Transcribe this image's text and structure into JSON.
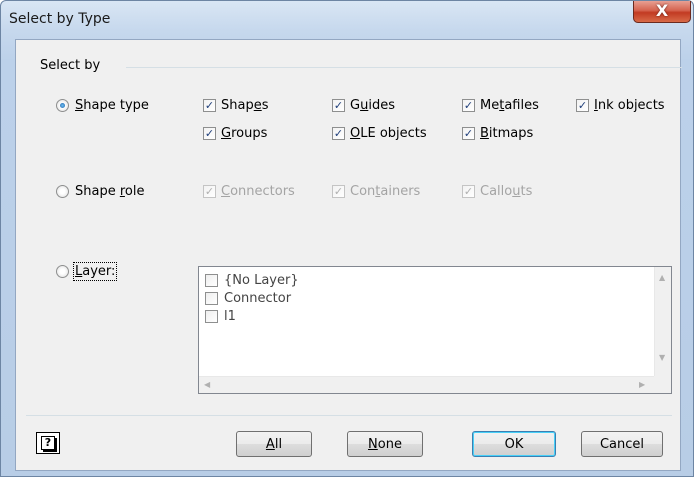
{
  "window": {
    "title": "Select by Type",
    "close_glyph": "X"
  },
  "group": {
    "label": "Select by"
  },
  "shape_type": {
    "label_pre": "",
    "label_key": "S",
    "label_post": "hape type",
    "selected": true,
    "options": [
      {
        "pre": "Shap",
        "key": "e",
        "post": "s",
        "checked": true
      },
      {
        "pre": "",
        "key": "G",
        "post": "roups",
        "checked": true
      },
      {
        "pre": "G",
        "key": "u",
        "post": "ides",
        "checked": true
      },
      {
        "pre": "",
        "key": "O",
        "post": "LE objects",
        "checked": true
      },
      {
        "pre": "Me",
        "key": "t",
        "post": "afiles",
        "checked": true
      },
      {
        "pre": "",
        "key": "B",
        "post": "itmaps",
        "checked": true
      },
      {
        "pre": "",
        "key": "I",
        "post": "nk objects",
        "checked": true
      }
    ]
  },
  "shape_role": {
    "label_pre": "Shape ",
    "label_key": "r",
    "label_post": "ole",
    "selected": false,
    "options": [
      {
        "pre": "",
        "key": "C",
        "post": "onnectors",
        "checked": true
      },
      {
        "pre": "Con",
        "key": "t",
        "post": "ainers",
        "checked": true
      },
      {
        "pre": "Callo",
        "key": "u",
        "post": "ts",
        "checked": true
      }
    ]
  },
  "layer": {
    "label_pre": "",
    "label_key": "L",
    "label_post": "ayer:",
    "selected": false,
    "items": [
      "{No Layer}",
      "Connector",
      "l1"
    ]
  },
  "buttons": {
    "help_glyph": "?",
    "all_key": "A",
    "all_post": "ll",
    "none_key": "N",
    "none_post": "one",
    "ok": "OK",
    "cancel": "Cancel"
  },
  "colors": {
    "check": "#1f3e7a",
    "close": "#c23a22",
    "default_border": "#3c7fb1"
  }
}
